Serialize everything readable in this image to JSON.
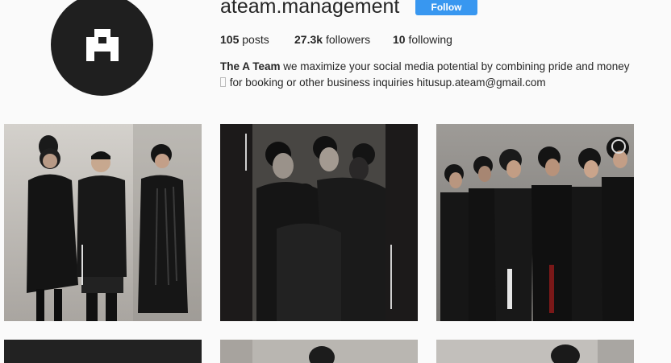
{
  "profile": {
    "username": "ateam.management",
    "follow_label": "Follow",
    "avatar_icon": "a-letter-logo"
  },
  "stats": {
    "posts_count": "105",
    "posts_label": "posts",
    "followers_count": "27.3k",
    "followers_label": "followers",
    "following_count": "10",
    "following_label": "following"
  },
  "bio": {
    "name": "The A Team",
    "line1_text": "we maximize your social media potential by combining pride and money",
    "line2_text": "for booking or other business inquiries hitusup.ateam@gmail.com"
  },
  "colors": {
    "follow_button": "#3897f0",
    "avatar_bg": "#1f1f1f",
    "page_bg": "#fafafa"
  }
}
